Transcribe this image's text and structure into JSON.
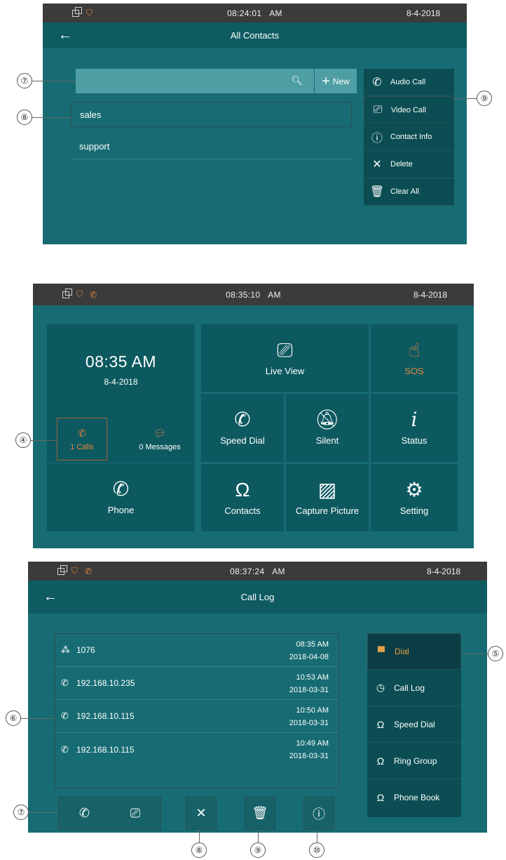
{
  "screen1": {
    "status": {
      "time": "08:24:01",
      "ampm": "AM",
      "date": "8-4-2018"
    },
    "title": "All Contacts",
    "search": {
      "placeholder": "",
      "new_label": "New"
    },
    "contacts": [
      "sales",
      "support"
    ],
    "menu": [
      "Audio Call",
      "Video Call",
      "Contact Info",
      "Delete",
      "Clear All"
    ],
    "callouts": [
      "⑦",
      "⑧",
      "⑨"
    ]
  },
  "screen2": {
    "status": {
      "time": "08:35:10",
      "ampm": "AM",
      "date": "8-4-2018"
    },
    "clock": "08:35 AM",
    "clock_date": "8-4-2018",
    "calls": "1 Calls",
    "messages": "0 Messages",
    "phone": "Phone",
    "tiles": [
      "Live View",
      "SOS",
      "Speed Dial",
      "Silent",
      "Status",
      "Contacts",
      "Capture Picture",
      "Setting"
    ],
    "callouts": [
      "④"
    ]
  },
  "screen3": {
    "status": {
      "time": "08:37:24",
      "ampm": "AM",
      "date": "8-4-2018"
    },
    "title": "Call Log",
    "logs": [
      {
        "number": "1076",
        "time": "08:35 AM",
        "date": "2018-04-08"
      },
      {
        "number": "192.168.10.235",
        "time": "10:53 AM",
        "date": "2018-03-31"
      },
      {
        "number": "192.168.10.115",
        "time": "10:50 AM",
        "date": "2018-03-31"
      },
      {
        "number": "192.168.10.115",
        "time": "10:49 AM",
        "date": "2018-03-31"
      }
    ],
    "side": [
      "Dial",
      "Call Log",
      "Speed Dial",
      "Ring Group",
      "Phone Book"
    ],
    "callouts": [
      "⑤",
      "⑥",
      "⑦",
      "⑧",
      "⑨",
      "⑩"
    ]
  },
  "colors": {
    "screen_bg": "#176c73",
    "tile_bg": "#0d5960",
    "accent": "#e6853a",
    "statusbar": "#3b3b3b"
  }
}
